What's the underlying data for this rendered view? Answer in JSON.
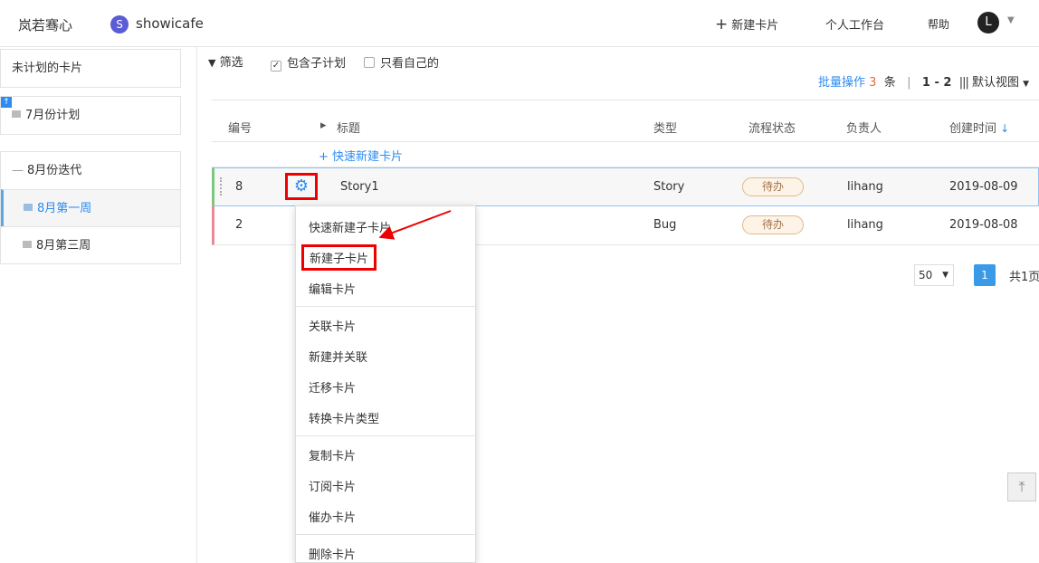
{
  "header": {
    "brand": "岚若骞心",
    "project_badge": "S",
    "project_name": "showicafe",
    "new_card": "新建卡片",
    "workbench": "个人工作台",
    "help": "帮助",
    "avatar": "L"
  },
  "sidebar": {
    "unplanned": "未计划的卡片",
    "july_plan": "7月份计划",
    "aug_iter": "8月份迭代",
    "aug_week1": "8月第一周",
    "aug_week3": "8月第三周"
  },
  "filter": {
    "filter_label": "筛选",
    "include_sub": "包含子计划",
    "include_sub_checked": true,
    "only_mine": "只看自己的",
    "only_mine_checked": false
  },
  "batch": {
    "label": "批量操作",
    "count": "3",
    "unit": "条",
    "sep": "|",
    "range": "1 - 2",
    "view": "默认视图"
  },
  "table": {
    "headers": {
      "id": "编号",
      "title": "标题",
      "type": "类型",
      "status": "流程状态",
      "owner": "负责人",
      "created": "创建时间"
    },
    "quick_create": "+ 快速新建卡片",
    "rows": [
      {
        "id": "8",
        "title": "Story1",
        "type": "Story",
        "status": "待办",
        "owner": "lihang",
        "created": "2019-08-09"
      },
      {
        "id": "2",
        "title": "",
        "type": "Bug",
        "status": "待办",
        "owner": "lihang",
        "created": "2019-08-08"
      }
    ]
  },
  "pager": {
    "page_size": "50",
    "current": "1",
    "total": "共1页"
  },
  "context_menu": {
    "items": [
      "快速新建子卡片",
      "新建子卡片",
      "编辑卡片",
      "关联卡片",
      "新建并关联",
      "迁移卡片",
      "转换卡片类型",
      "复制卡片",
      "订阅卡片",
      "催办卡片",
      "删除卡片"
    ]
  },
  "colors": {
    "accent": "#2d8cf0",
    "highlight": "#e00000",
    "status_border": "#e0b98a"
  }
}
